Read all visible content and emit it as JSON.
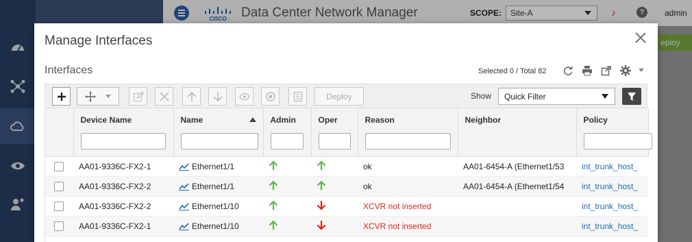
{
  "app": {
    "title": "Data Center Network Manager",
    "scope_label": "SCOPE:",
    "scope_value": "Site-A",
    "user": "admin",
    "bg_deploy_label": "eploy",
    "sidebar_icons": [
      "dashboard-icon",
      "topology-icon",
      "cloud-icon",
      "eye-icon",
      "admin-settings-icon"
    ]
  },
  "modal": {
    "title": "Manage Interfaces",
    "section_title": "Interfaces",
    "selected_info": "Selected 0 / Total 82"
  },
  "toolbar": {
    "deploy_label": "Deploy",
    "show_label": "Show",
    "filter_value": "Quick Filter"
  },
  "table": {
    "columns": [
      "",
      "Device Name",
      "Name",
      "Admin",
      "Oper",
      "Reason",
      "Neighbor",
      "Policy"
    ],
    "rows": [
      {
        "device": "AA01-9336C-FX2-1",
        "name": "Ethernet1/1",
        "admin": "up",
        "oper": "up",
        "reason": "ok",
        "reason_error": false,
        "neighbor": "AA01-6454-A (Ethernet1/53",
        "policy": "int_trunk_host_"
      },
      {
        "device": "AA01-9336C-FX2-2",
        "name": "Ethernet1/1",
        "admin": "up",
        "oper": "up",
        "reason": "ok",
        "reason_error": false,
        "neighbor": "AA01-6454-A (Ethernet1/54",
        "policy": "int_trunk_host_"
      },
      {
        "device": "AA01-9336C-FX2-2",
        "name": "Ethernet1/10",
        "admin": "up",
        "oper": "down",
        "reason": "XCVR not inserted",
        "reason_error": true,
        "neighbor": "",
        "policy": "int_trunk_host_"
      },
      {
        "device": "AA01-9336C-FX2-1",
        "name": "Ethernet1/10",
        "admin": "up",
        "oper": "down",
        "reason": "XCVR not inserted",
        "reason_error": true,
        "neighbor": "",
        "policy": "int_trunk_host_"
      }
    ]
  },
  "colors": {
    "up_arrow": "#5fb54a",
    "down_arrow": "#e0251b",
    "error_text": "#e0251b",
    "link": "#1f6bb8"
  }
}
